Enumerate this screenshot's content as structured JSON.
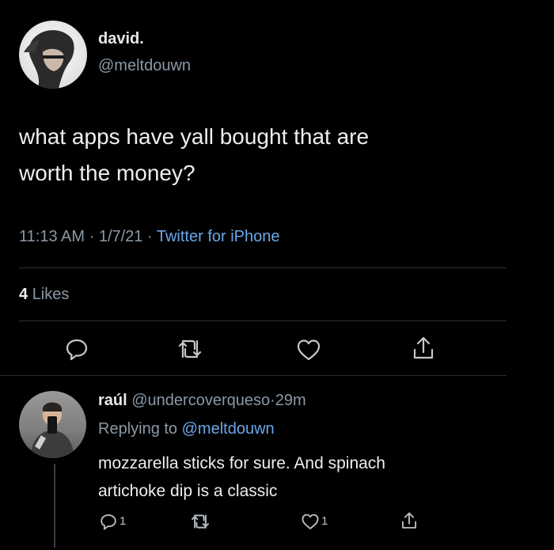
{
  "tweet": {
    "display_name": "david.",
    "handle": "@meltdouwn",
    "text_line1": "what apps have yall bought that are",
    "text_line2": "worth the money?",
    "time": "11:13 AM",
    "sep1": "·",
    "date": "1/7/21",
    "sep2": "·",
    "source": "Twitter for iPhone",
    "likes_count": "4",
    "likes_label": "Likes"
  },
  "reply": {
    "display_name": "raúl",
    "handle": "@undercoverqueso",
    "sep": "·",
    "age": "29m",
    "replying_prefix": "Replying to",
    "replying_handle": "@meltdouwn",
    "text_line1": "mozzarella sticks for sure. And spinach",
    "text_line2": "artichoke dip is a classic",
    "reply_count": "1",
    "like_count": "1"
  },
  "icons": {
    "reply": "reply-icon",
    "retweet": "retweet-icon",
    "like": "heart-icon",
    "share": "share-icon"
  },
  "colors": {
    "background": "#000000",
    "text": "#e7e9ea",
    "muted": "#8b98a5",
    "link": "#6aa7e8"
  }
}
